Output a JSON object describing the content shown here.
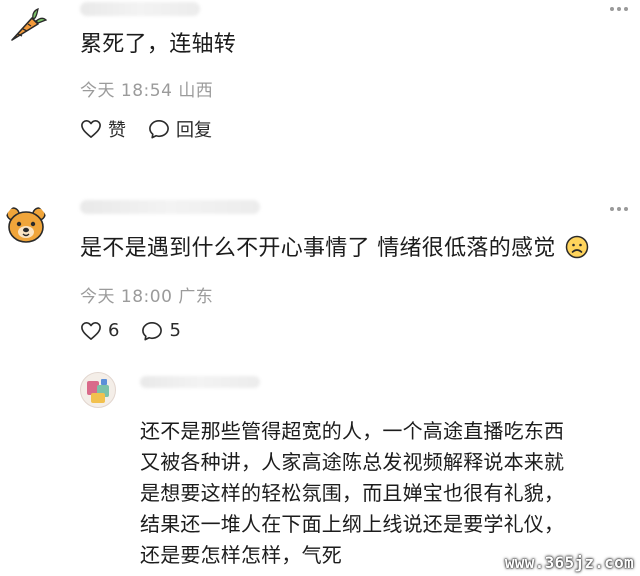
{
  "comments": [
    {
      "avatar_icon": "carrot-icon",
      "text": "累死了，连轴转",
      "time": "今天 18:54",
      "location": "山西",
      "like_label": "赞",
      "reply_label": "回复"
    },
    {
      "avatar_icon": "bear-icon",
      "text": "是不是遇到什么不开心事情了 情绪很低落的感觉",
      "emoji_icon": "sad-face-icon",
      "time": "今天 18:00",
      "location": "广东",
      "like_count": "6",
      "reply_count": "5"
    }
  ],
  "reply": {
    "lines": [
      "还不是那些管得超宽的人，一个高途直播吃东西",
      "又被各种讲，人家高途陈总发视频解释说本来就",
      "是想要这样的轻松氛围，而且婵宝也很有礼貌，",
      "结果还一堆人在下面上纲上线说还是要学礼仪，",
      "还是要怎样怎样，气死"
    ]
  },
  "watermark": "www.365jz.com",
  "colors": {
    "meta": "#9b9b9b",
    "text": "#1c1c1c",
    "icon": "#2b2b2b"
  }
}
